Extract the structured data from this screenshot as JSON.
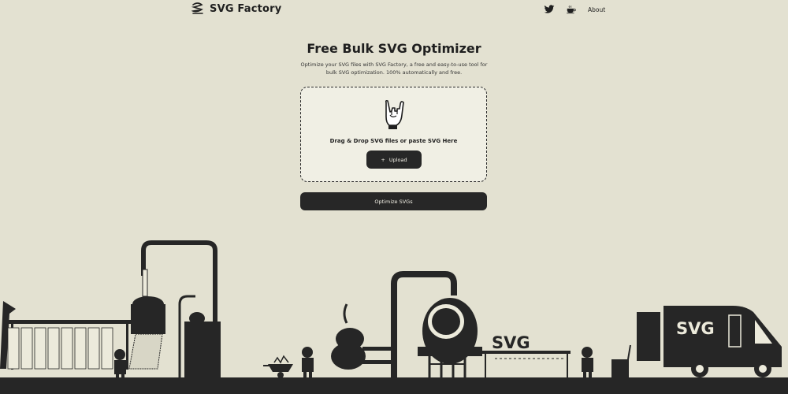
{
  "brand": {
    "name": "SVG Factory"
  },
  "nav": {
    "about": "About",
    "icons": [
      "twitter-icon",
      "coffee-icon"
    ]
  },
  "hero": {
    "title": "Free Bulk SVG Optimizer",
    "subtitle": "Optimize your SVG files with SVG Factory, a free and easy-to-use tool for bulk SVG optimization. 100% automatically and free."
  },
  "dropzone": {
    "text": "Drag & Drop SVG files or paste SVG Here",
    "upload_label": "Upload",
    "icon": "rock-hand-icon"
  },
  "optimize": {
    "label": "Optimize SVGs"
  },
  "scene": {
    "sign_text": "SVG",
    "van_text": "SVG"
  },
  "colors": {
    "background": "#e3e1d1",
    "dark": "#272727",
    "panel": "#f0efe4"
  }
}
